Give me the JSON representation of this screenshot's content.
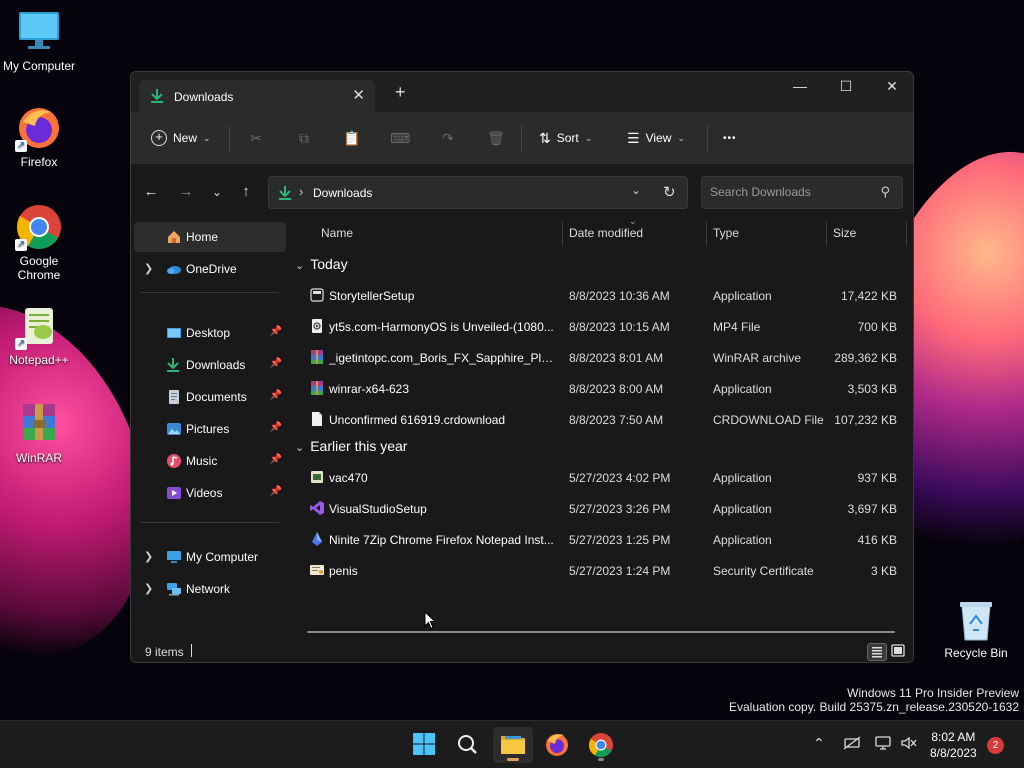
{
  "desktop": {
    "icons": [
      {
        "label": "My Computer"
      },
      {
        "label": "Firefox"
      },
      {
        "label": "Google Chrome"
      },
      {
        "label": "Notepad++"
      },
      {
        "label": "WinRAR"
      }
    ],
    "recycle_bin": "Recycle Bin",
    "watermark_line1": "Windows 11 Pro Insider Preview",
    "watermark_line2": "Evaluation copy. Build 25375.zn_release.230520-1632"
  },
  "window": {
    "tab_title": "Downloads",
    "toolbar": {
      "new_label": "New",
      "sort_label": "Sort",
      "view_label": "View",
      "more_label": "•••"
    },
    "address": {
      "separator": "›",
      "location": "Downloads"
    },
    "search": {
      "placeholder": "Search Downloads"
    },
    "nav": {
      "items": [
        {
          "label": "Home"
        },
        {
          "label": "OneDrive"
        },
        {
          "label": "Desktop"
        },
        {
          "label": "Downloads"
        },
        {
          "label": "Documents"
        },
        {
          "label": "Pictures"
        },
        {
          "label": "Music"
        },
        {
          "label": "Videos"
        },
        {
          "label": "My Computer"
        },
        {
          "label": "Network"
        }
      ]
    },
    "columns": {
      "name": "Name",
      "date": "Date modified",
      "type": "Type",
      "size": "Size"
    },
    "groups": [
      {
        "label": "Today",
        "files": [
          {
            "name": "StorytellerSetup",
            "date": "8/8/2023 10:36 AM",
            "type": "Application",
            "size": "17,422 KB",
            "icon": "app-icon"
          },
          {
            "name": "yt5s.com-HarmonyOS is Unveiled-(1080...",
            "date": "8/8/2023 10:15 AM",
            "type": "MP4 File",
            "size": "700 KB",
            "icon": "video-file-icon"
          },
          {
            "name": "_igetintopc.com_Boris_FX_Sapphire_Plug...",
            "date": "8/8/2023 8:01 AM",
            "type": "WinRAR archive",
            "size": "289,362 KB",
            "icon": "winrar-archive-icon"
          },
          {
            "name": "winrar-x64-623",
            "date": "8/8/2023 8:00 AM",
            "type": "Application",
            "size": "3,503 KB",
            "icon": "winrar-installer-icon"
          },
          {
            "name": "Unconfirmed 616919.crdownload",
            "date": "8/8/2023 7:50 AM",
            "type": "CRDOWNLOAD File",
            "size": "107,232 KB",
            "icon": "blank-file-icon"
          }
        ]
      },
      {
        "label": "Earlier this year",
        "files": [
          {
            "name": "vac470",
            "date": "5/27/2023 4:02 PM",
            "type": "Application",
            "size": "937 KB",
            "icon": "installer-icon"
          },
          {
            "name": "VisualStudioSetup",
            "date": "5/27/2023 3:26 PM",
            "type": "Application",
            "size": "3,697 KB",
            "icon": "visual-studio-icon"
          },
          {
            "name": "Ninite 7Zip Chrome Firefox Notepad Inst...",
            "date": "5/27/2023 1:25 PM",
            "type": "Application",
            "size": "416 KB",
            "icon": "ninite-icon"
          },
          {
            "name": "penis",
            "date": "5/27/2023 1:24 PM",
            "type": "Security Certificate",
            "size": "3 KB",
            "icon": "certificate-icon"
          }
        ]
      }
    ],
    "status": {
      "count": "9 items"
    }
  },
  "taskbar": {
    "time": "8:02 AM",
    "date": "8/8/2023",
    "notifications": "2"
  },
  "colors": {
    "accent": "#4cc2ff",
    "download_green": "#2fb47c",
    "folder_yellow": "#f0c040"
  }
}
